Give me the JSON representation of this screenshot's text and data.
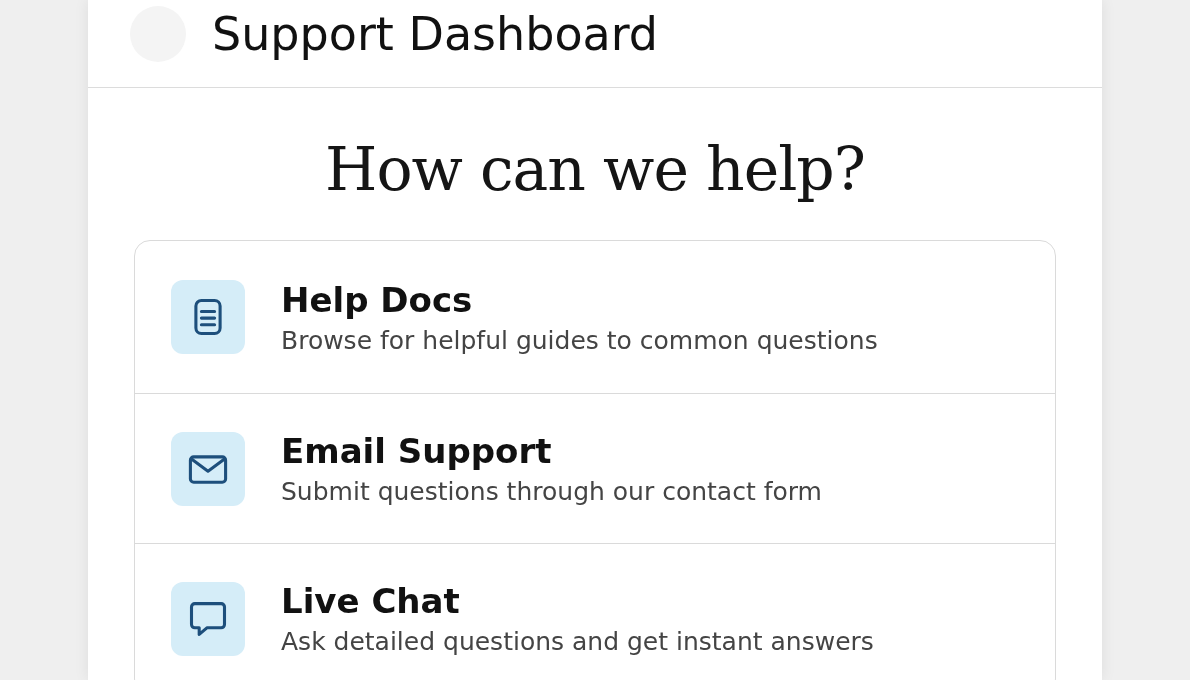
{
  "header": {
    "title": "Support Dashboard"
  },
  "heading": "How can we help?",
  "options": [
    {
      "kind": "docs",
      "title": "Help Docs",
      "description": "Browse for helpful guides to common questions"
    },
    {
      "kind": "email",
      "title": "Email Support",
      "description": "Submit questions through our contact form"
    },
    {
      "kind": "chat",
      "title": "Live Chat",
      "description": "Ask detailed questions and get instant answers"
    }
  ]
}
